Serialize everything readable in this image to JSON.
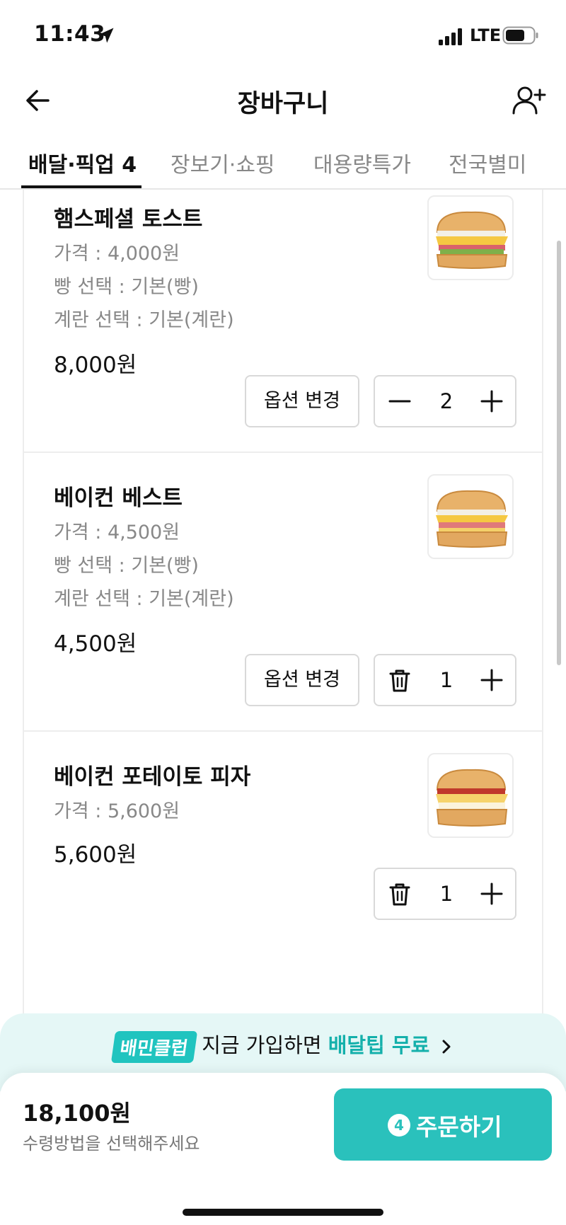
{
  "status": {
    "time": "11:43",
    "network": "LTE"
  },
  "header": {
    "title": "장바구니"
  },
  "tabs": [
    {
      "label": "배달·픽업 4",
      "active": true
    },
    {
      "label": "장보기·쇼핑"
    },
    {
      "label": "대용량특가"
    },
    {
      "label": "전국별미"
    }
  ],
  "items": [
    {
      "name": "햄스페셜 토스트",
      "options": [
        "가격 : 4,000원",
        "빵 선택 : 기본(빵)",
        "계란 선택 : 기본(계란)"
      ],
      "total": "8,000원",
      "option_button": "옵션 변경",
      "quantity": "2",
      "left_control": "minus"
    },
    {
      "name": "베이컨 베스트",
      "options": [
        "가격 : 4,500원",
        "빵 선택 : 기본(빵)",
        "계란 선택 : 기본(계란)"
      ],
      "total": "4,500원",
      "option_button": "옵션 변경",
      "quantity": "1",
      "left_control": "trash"
    },
    {
      "name": "베이컨 포테이토 피자",
      "options": [
        "가격 : 5,600원"
      ],
      "total": "5,600원",
      "quantity": "1",
      "left_control": "trash"
    }
  ],
  "promo": {
    "badge": "배민클럽",
    "text": "지금 가입하면",
    "highlight": "배달팁 무료"
  },
  "footer": {
    "total": "18,100원",
    "hint": "수령방법을 선택해주세요",
    "order_count": "4",
    "order_label": "주문하기"
  },
  "colors": {
    "accent": "#2ac1bc",
    "promo_bg": "#e5f7f6",
    "muted_text": "#888888"
  }
}
